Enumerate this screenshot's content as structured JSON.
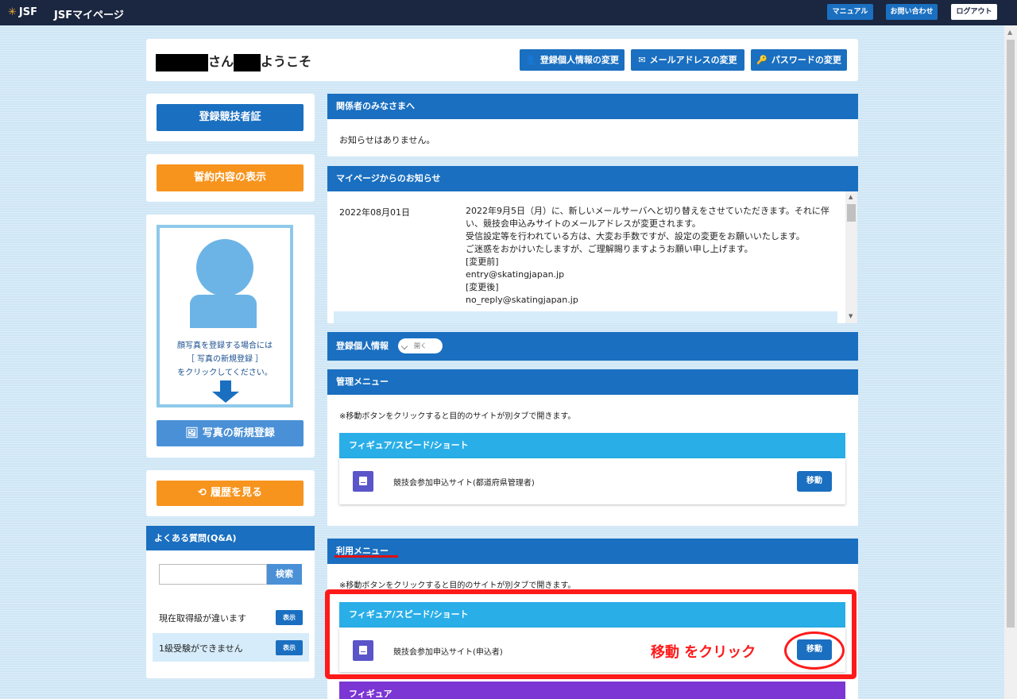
{
  "header": {
    "logo_text": "JSF",
    "app_title": "JSFマイページ",
    "manual": "マニュアル",
    "contact": "お問い合わせ",
    "logout": "ログアウト"
  },
  "welcome": {
    "san": "さん",
    "greeting": "ようこそ",
    "buttons": {
      "profile": "登録個人情報の変更",
      "email": "メールアドレスの変更",
      "password": "パスワードの変更"
    }
  },
  "sidebar": {
    "license_button": "登録競技者証",
    "pledge_button": "誓約内容の表示",
    "photo": {
      "line1": "顔写真を登録する場合には",
      "line2": "［ 写真の新規登録 ］",
      "line3": "をクリックしてください。",
      "register_button": "写真の新規登録"
    },
    "history_button": "履歴を見る",
    "faq": {
      "title": "よくある質問(Q&A)",
      "search_button": "検索",
      "search_value": "",
      "items": [
        {
          "text": "現在取得級が違います",
          "button": "表示"
        },
        {
          "text": "1級受験ができません",
          "button": "表示"
        }
      ]
    }
  },
  "panels": {
    "notice_title": "関係者のみなさまへ",
    "notice_body": "お知らせはありません。",
    "mypage_news_title": "マイページからのお知らせ",
    "news": {
      "date": "2022年08月01日",
      "lines": [
        "2022年9月5日（月）に、新しいメールサーバへと切り替えをさせていただきます。それに伴",
        "い、競技会申込みサイトのメールアドレスが変更されます。",
        "受信設定等を行われている方は、大変お手数ですが、設定の変更をお願いいたします。",
        "ご迷惑をおかけいたしますが、ご理解賜りますようお願い申し上げます。",
        "[変更前]",
        "entry@skatingjapan.jp",
        "[変更後]",
        "no_reply@skatingjapan.jp"
      ]
    },
    "personal_info_title": "登録個人情報",
    "personal_info_toggle": "開く",
    "admin_menu_title": "管理メニュー",
    "admin_note": "※移動ボタンをクリックすると目的のサイトが別タブで開きます。",
    "admin_group": "フィギュア/スピード/ショート",
    "admin_site": "競技会参加申込サイト(都道府県管理者)",
    "admin_move": "移動",
    "user_menu_title": "利用メニュー",
    "user_note": "※移動ボタンをクリックすると目的のサイトが別タブで開きます。",
    "user_group": "フィギュア/スピード/ショート",
    "user_site": "競技会参加申込サイト(申込者)",
    "user_move": "移動",
    "next_group": "フィギュア"
  },
  "annotation": {
    "text": "移動  をクリック",
    "color": "#ff1a1a"
  },
  "colors": {
    "primary": "#1a6fc0",
    "orange": "#f7941d",
    "sky": "#29aee8",
    "purple": "#7b36d3",
    "topbar": "#1b2640"
  }
}
